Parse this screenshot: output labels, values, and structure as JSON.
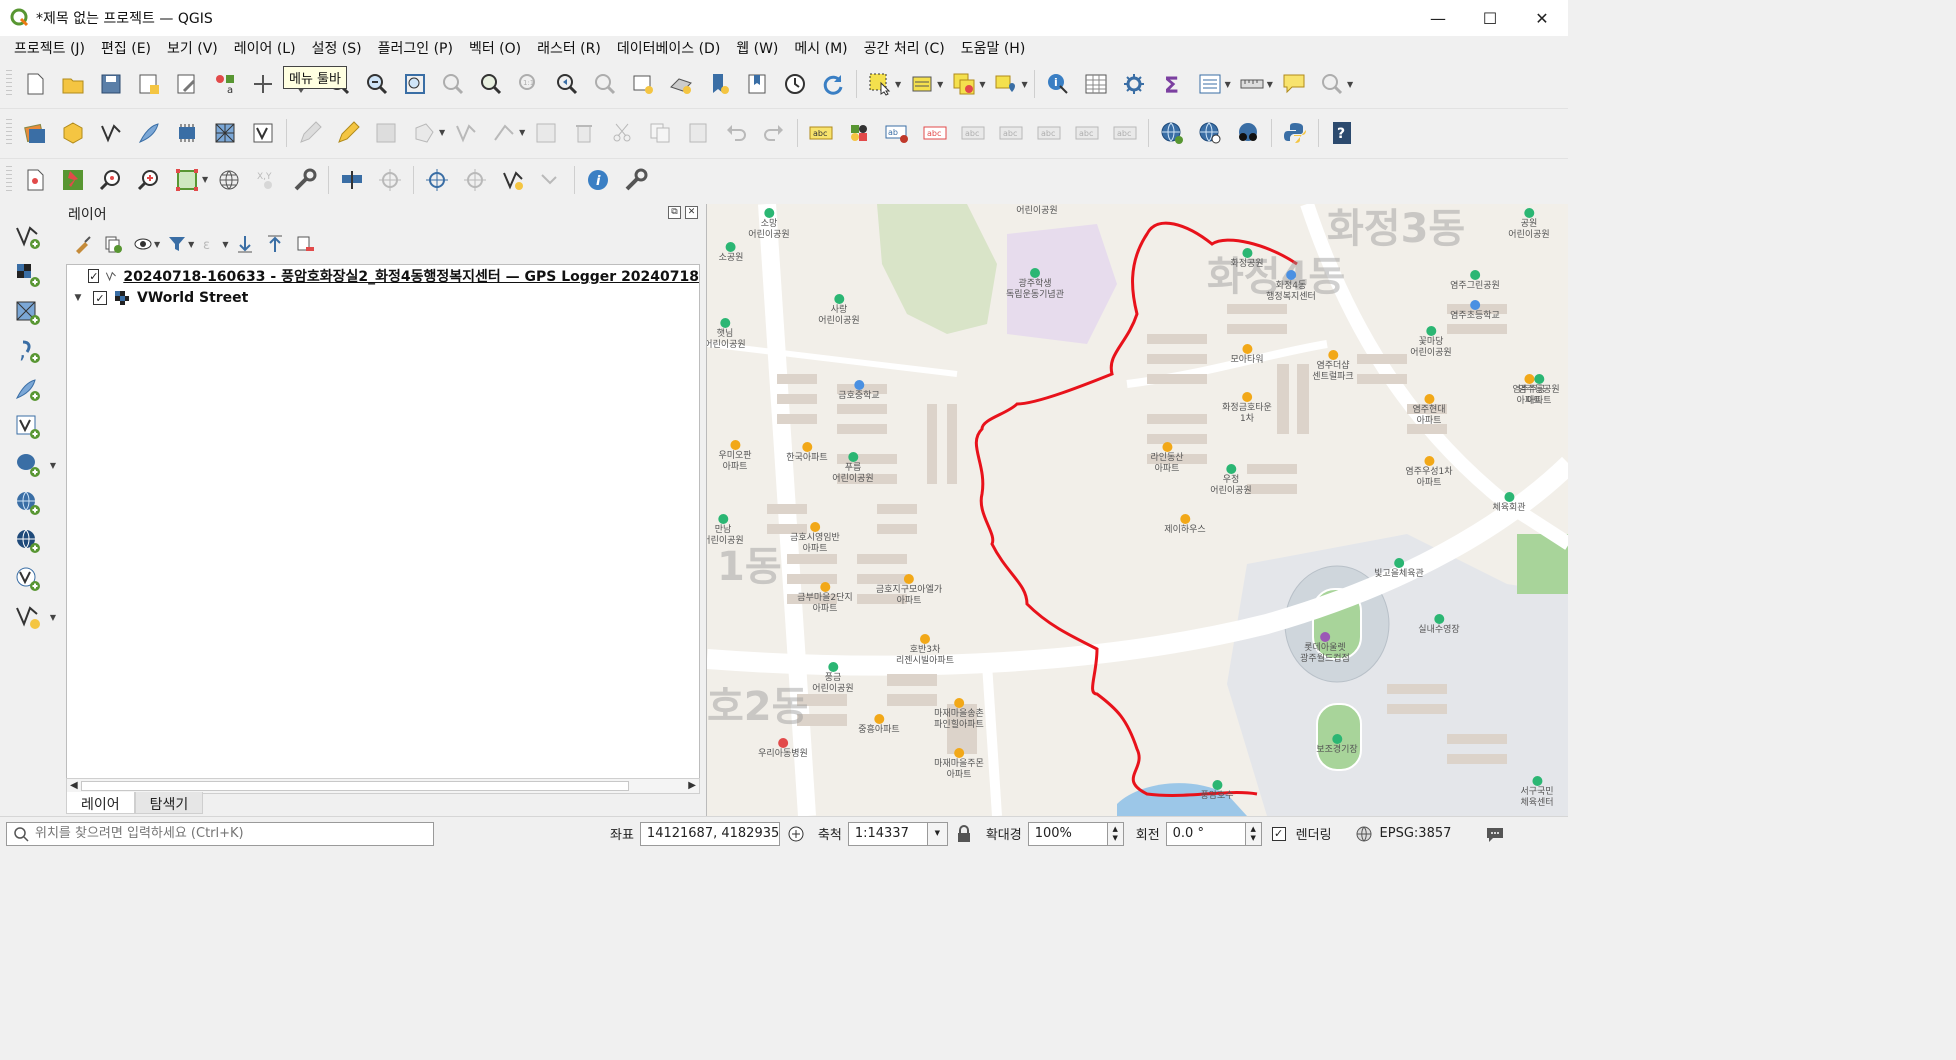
{
  "window": {
    "title": "*제목 없는 프로젝트 — QGIS",
    "minimize": "—",
    "maximize": "☐",
    "close": "✕"
  },
  "menu": [
    "프로젝트 (J)",
    "편집 (E)",
    "보기 (V)",
    "레이어 (L)",
    "설정 (S)",
    "플러그인 (P)",
    "벡터 (O)",
    "래스터 (R)",
    "데이터베이스 (D)",
    "웹 (W)",
    "메시 (M)",
    "공간 처리 (C)",
    "도움말 (H)"
  ],
  "tooltip": "메뉴 툴바",
  "layers_panel": {
    "title": "레이어",
    "layers": [
      {
        "name": "20240718-160633 - 풍암호화장실2_화정4동행정복지센터 — GPS Logger 20240718",
        "checked": "✓",
        "icon": "line-layer-icon"
      },
      {
        "name": "VWorld Street",
        "checked": "✓",
        "icon": "raster-tile-icon"
      }
    ],
    "tabs": [
      "레이어",
      "탐색기"
    ]
  },
  "map": {
    "districts": [
      "화정4동",
      "1동",
      "호2동",
      "화정3동"
    ],
    "track_color": "#e8121b",
    "pois": [
      {
        "label": "소망\n어린이공원",
        "color": "#2bb673"
      },
      {
        "label": "어린이공원",
        "color": ""
      },
      {
        "label": "소공원",
        "color": "#2bb673"
      },
      {
        "label": "광주학생\n독립운동기념관",
        "color": "#2bb673"
      },
      {
        "label": "사랑\n어린이공원",
        "color": "#2bb673"
      },
      {
        "label": "햇님\n어린이공원",
        "color": "#2bb673"
      },
      {
        "label": "금호중학교",
        "color": "#4a90e2"
      },
      {
        "label": "우미오판\n아파트",
        "color": "#f2a818"
      },
      {
        "label": "한국아파트",
        "color": "#f2a818"
      },
      {
        "label": "푸름\n어린이공원",
        "color": "#2bb673"
      },
      {
        "label": "만남\n어린이공원",
        "color": "#2bb673"
      },
      {
        "label": "금호시영임반\n아파트",
        "color": "#f2a818"
      },
      {
        "label": "금부마을2단지\n아파트",
        "color": "#f2a818"
      },
      {
        "label": "금호지구모아엘가\n아파트",
        "color": "#f2a818"
      },
      {
        "label": "호반3차\n리젠시빌아파트",
        "color": "#f2a818"
      },
      {
        "label": "풍금\n어린이공원",
        "color": "#2bb673"
      },
      {
        "label": "중흥아파트",
        "color": "#f2a818"
      },
      {
        "label": "마재마을송촌\n파인힐아파트",
        "color": "#f2a818"
      },
      {
        "label": "마재마을주몬\n아파트",
        "color": "#f2a818"
      },
      {
        "label": "우리아동병원",
        "color": "#e24a4a"
      },
      {
        "label": "화정4동\n행정복지센터",
        "color": "#4a90e2"
      },
      {
        "label": "모아타워",
        "color": "#f2a818"
      },
      {
        "label": "화정금호타운\n1차",
        "color": "#f2a818"
      },
      {
        "label": "라인동산\n아파트",
        "color": "#f2a818"
      },
      {
        "label": "우정\n어린이공원",
        "color": "#2bb673"
      },
      {
        "label": "제이하우스",
        "color": "#f2a818"
      },
      {
        "label": "염주더샵\n센트럴파크",
        "color": "#f2a818"
      },
      {
        "label": "꽃마당\n어린이공원",
        "color": "#2bb673"
      },
      {
        "label": "염주현대\n아파트",
        "color": "#f2a818"
      },
      {
        "label": "염주우성1차\n아파트",
        "color": "#f2a818"
      },
      {
        "label": "염주주공\n아파트",
        "color": "#f2a818"
      },
      {
        "label": "염주그린공원",
        "color": "#2bb673"
      },
      {
        "label": "염주초등학교",
        "color": "#4a90e2"
      },
      {
        "label": "체육회관",
        "color": "#2bb673"
      },
      {
        "label": "빛고을체육관",
        "color": "#2bb673"
      },
      {
        "label": "실내수영장",
        "color": "#2bb673"
      },
      {
        "label": "롯데아울렛\n광주월드컵점",
        "color": "#9b59b6"
      },
      {
        "label": "보조경기장",
        "color": "#2bb673"
      },
      {
        "label": "염주동공원\n아파트",
        "color": "#2bb673"
      },
      {
        "label": "공원\n어린이공원",
        "color": "#2bb673"
      },
      {
        "label": "풍암호수",
        "color": "#2bb673"
      },
      {
        "label": "화정공원",
        "color": "#2bb673"
      },
      {
        "label": "서구국민\n체육센터",
        "color": "#2bb673"
      }
    ]
  },
  "status": {
    "locator_placeholder": "위치를 찾으려면 입력하세요 (Ctrl+K)",
    "coord_label": "좌표",
    "coord_value": "14121687, 4182935",
    "scale_label": "축척",
    "scale_value": "1:14337",
    "magnifier_label": "확대경",
    "magnifier_value": "100%",
    "rotation_label": "회전",
    "rotation_value": "0.0 °",
    "render_label": "렌더링",
    "render_checked": "✓",
    "crs": "EPSG:3857"
  }
}
